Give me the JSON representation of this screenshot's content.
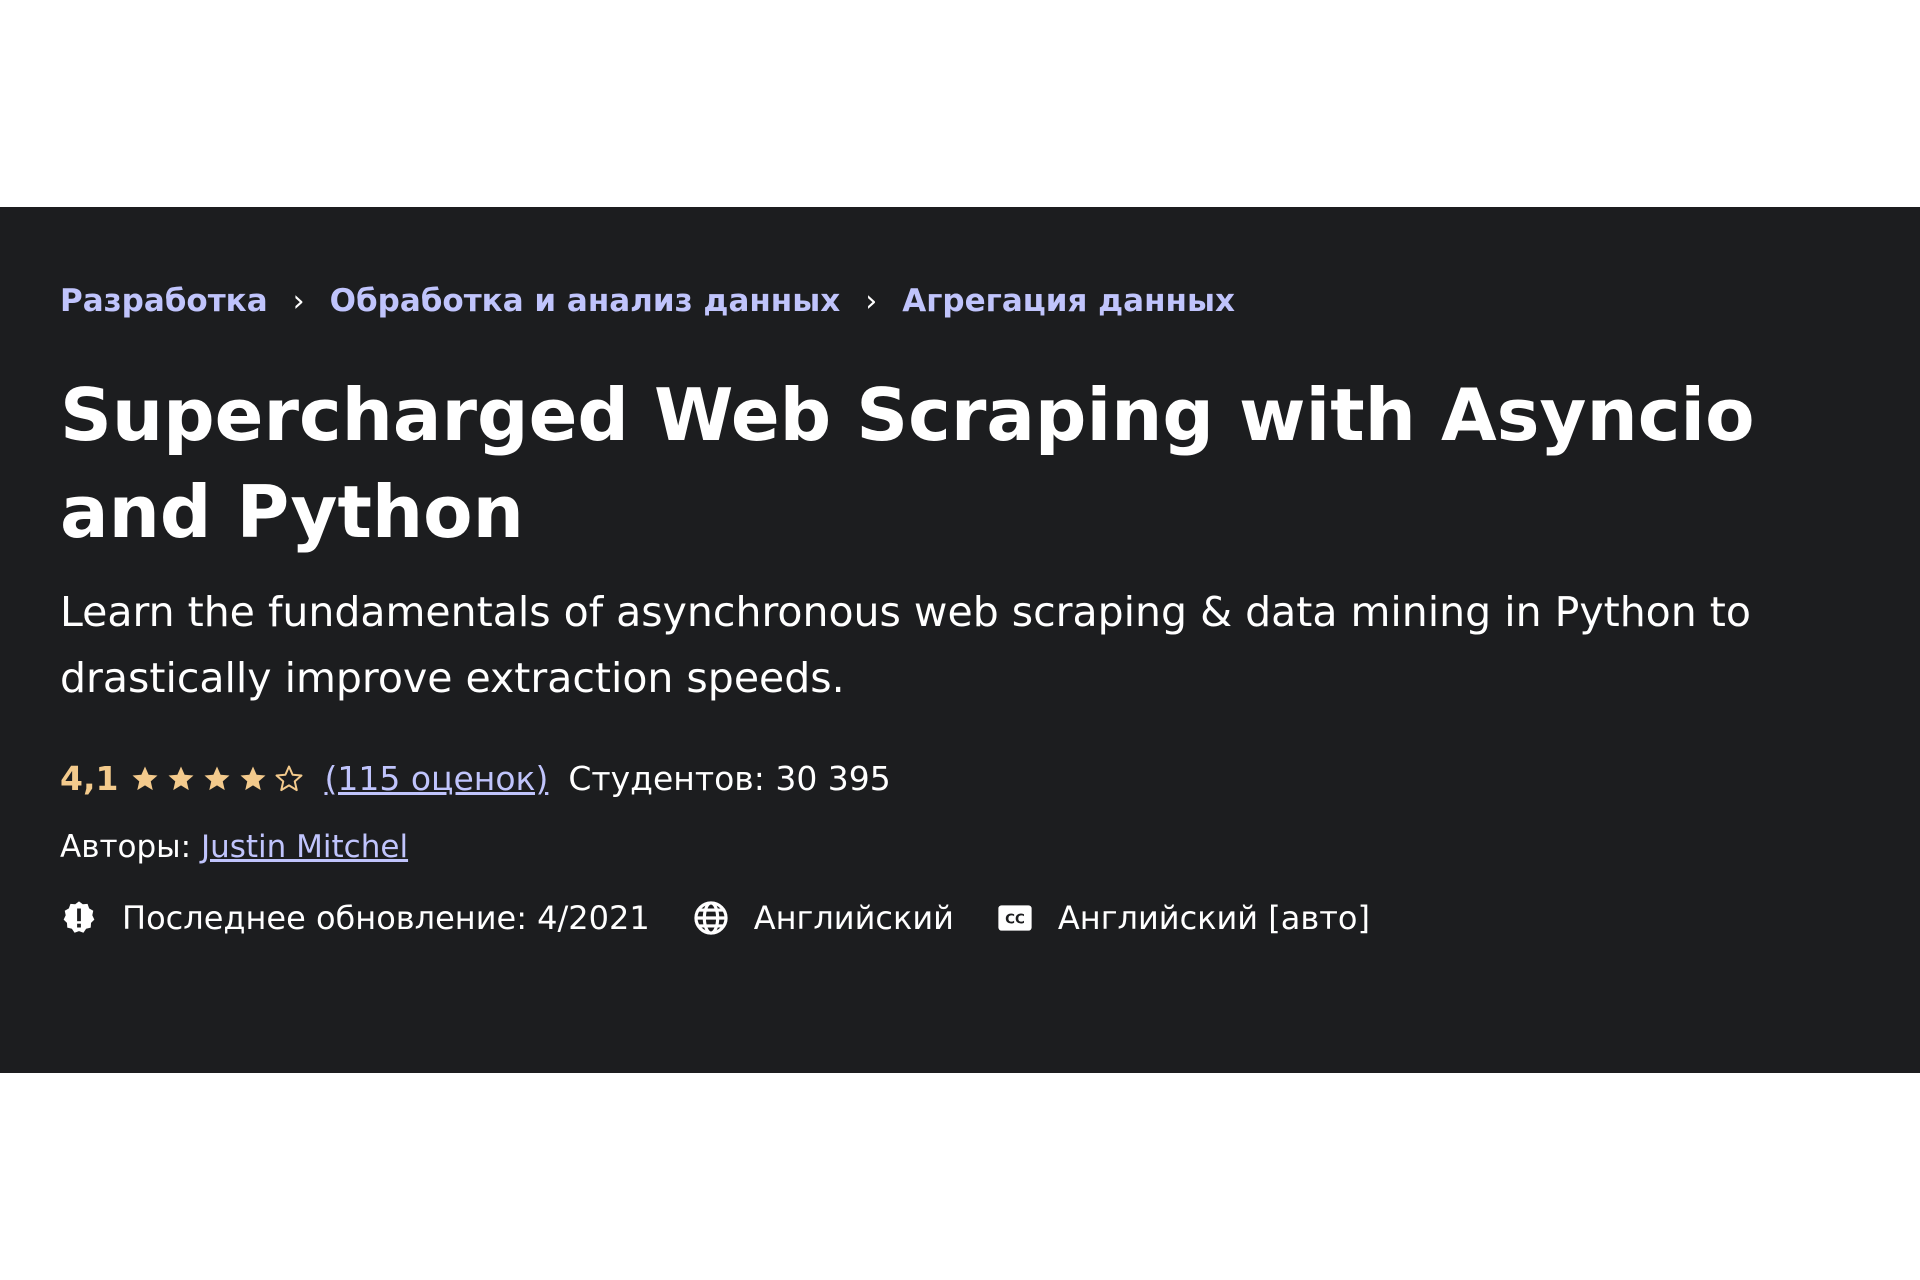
{
  "breadcrumb": {
    "items": [
      "Разработка",
      "Обработка и анализ данных",
      "Агрегация данных"
    ]
  },
  "course": {
    "title": "Supercharged Web Scraping with Asyncio and Python",
    "subtitle": "Learn the fundamentals of asynchronous web scraping & data mining in Python to drastically improve extraction speeds.",
    "rating": "4,1",
    "rating_value": 4.1,
    "stars_max": 5,
    "ratings_count_label": "(115 оценок)",
    "students_label": "Студентов: 30 395",
    "authors_label": "Авторы: ",
    "author_name": "Justin Mitchel"
  },
  "meta": {
    "last_update": "Последнее обновление: 4/2021",
    "language": "Английский",
    "captions": "Английский [авто]"
  },
  "icons": {
    "update": "alert-badge-icon",
    "language": "globe-icon",
    "captions": "closed-captions-icon"
  },
  "colors": {
    "background": "#1c1d1f",
    "link": "#c0c4fc",
    "rating": "#f3ca8c",
    "text": "#ffffff"
  }
}
